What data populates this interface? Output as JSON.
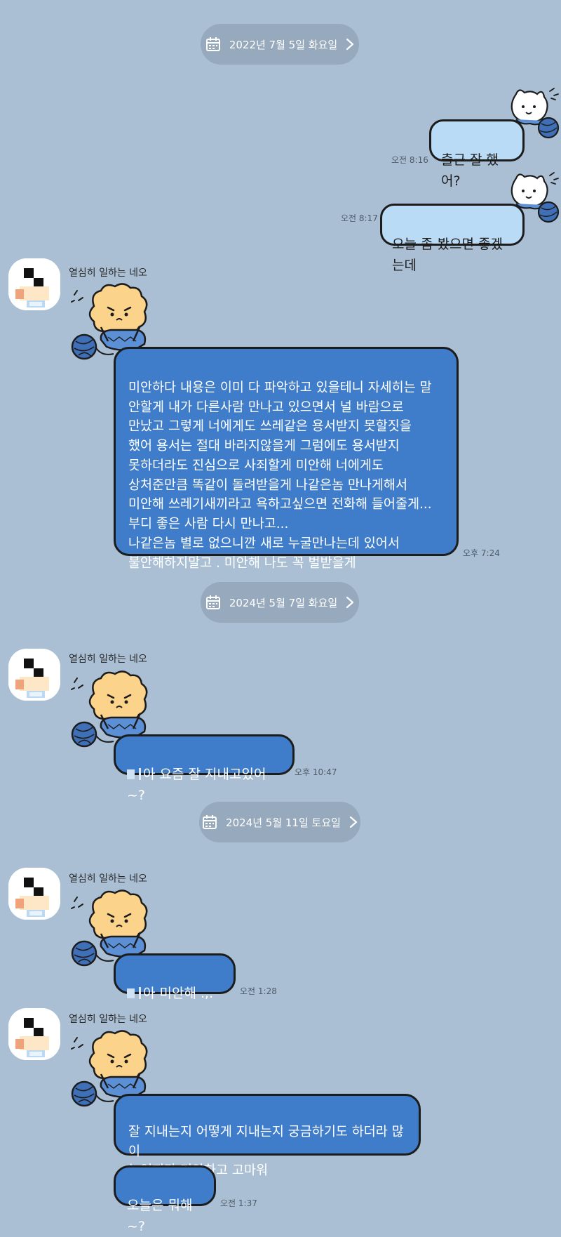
{
  "dates": [
    {
      "label": "2022년 7월 5일 화요일"
    },
    {
      "label": "2024년 5월 7일 화요일"
    },
    {
      "label": "2024년 5월 11일 토요일"
    }
  ],
  "contact": {
    "name": "열심히 일하는 네오"
  },
  "sent": [
    {
      "text": "출근 잘 했어?",
      "time": "오전 8:16"
    },
    {
      "text": "오늘 좀 봤으면 좋겠는데",
      "time": "오전 8:17"
    }
  ],
  "received": [
    {
      "text": "미안하다 내용은 이미 다 파악하고 있을테니 자세히는 말\n안할게 내가 다른사람 만나고 있으면서 널 바람으로\n만났고 그렇게 너에게도 쓰레같은 용서받지 못할짓을\n했어 용서는 절대 바라지않을게 그럼에도 용서받지\n못하더라도 진심으로 사죄할게 미안해 너에게도\n상처준만큼 똑같이 돌려받을게 나같은놈 만나게해서\n미안해 쓰레기새끼라고 욕하고싶으면 전화해 들어줄게...\n부디 좋은 사람 다시 만나고...\n나같은놈 별로 없으니깐 새로 누굴만나는데 있어서\n불안해하지말고 . 미안해 나도 꼭 벌받을게",
      "time": "오후 7:24"
    },
    {
      "text": "아 요즘 잘 지내고있어~?",
      "time": "오후 10:47"
    },
    {
      "text": "아 미안해 .,.",
      "time": "오전 1:28"
    },
    {
      "text": "잘 지내는지 어떻게 지내는지 궁금하기도 하더라 많이\n늙었지만 미안하고 고마워",
      "time": ""
    },
    {
      "text": "오늘은 뭐해~?",
      "time": "오전 1:37"
    }
  ],
  "colors": {
    "background": "#aabfd4",
    "sent_bubble": "#b9dbf6",
    "received_bubble": "#3f7dcb",
    "date_pill": "#97a9bc"
  },
  "icons": {
    "date": "calendar-icon",
    "chevron": "chevron-right-icon",
    "sent_sticker": "white-cat-knitting-icon",
    "received_sticker": "bear-knitting-icon",
    "avatar": "pixel-avatar-icon"
  }
}
